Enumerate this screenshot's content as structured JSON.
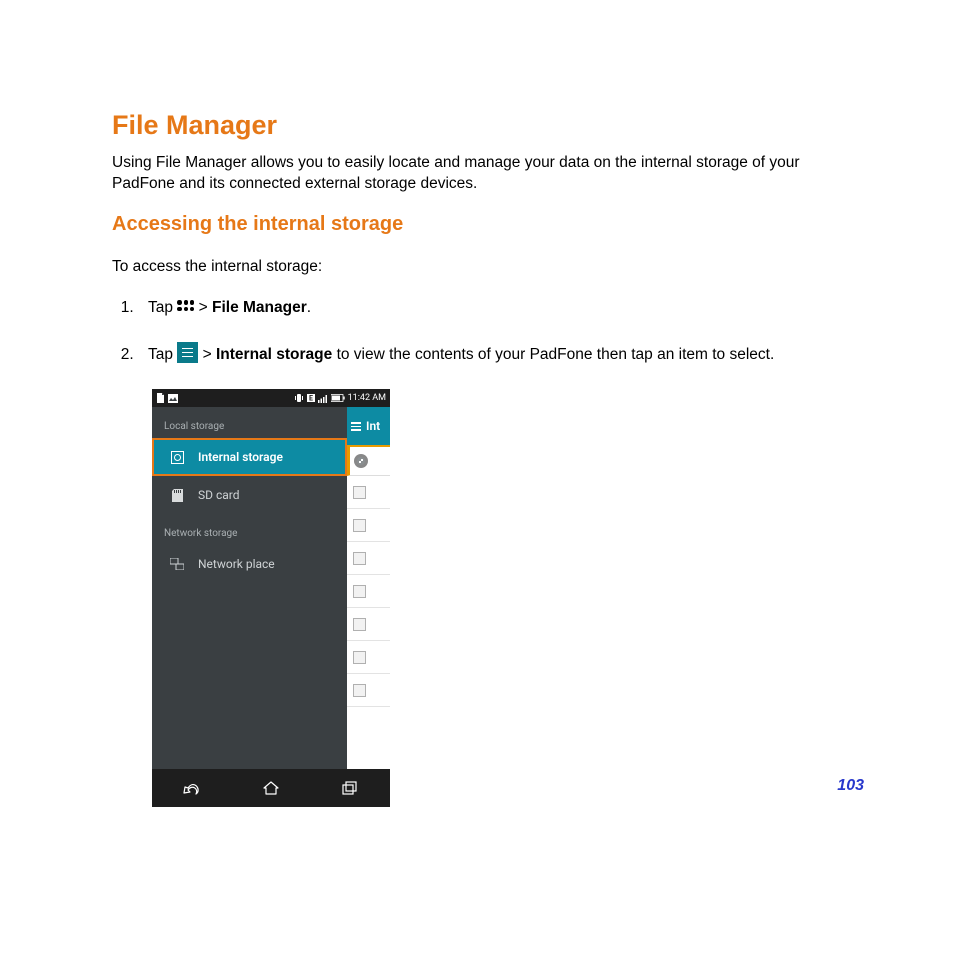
{
  "section": {
    "title": "File Manager",
    "intro": "Using File Manager allows you to easily locate and manage your data on the internal storage of your PadFone and its connected external storage devices.",
    "subtitle": "Accessing the internal storage",
    "lead": "To access the internal storage:"
  },
  "steps": {
    "one_tap": "Tap ",
    "one_gt": " > ",
    "one_target": "File Manager",
    "one_period": ".",
    "two_tap": "Tap ",
    "two_gt": " > ",
    "two_target": "Internal storage",
    "two_rest": " to view the contents of your PadFone then tap an item to select."
  },
  "phone": {
    "time": "11:42 AM",
    "local_label": "Local storage",
    "internal": "Internal storage",
    "sdcard": "SD card",
    "network_label": "Network storage",
    "network_place": "Network place",
    "right_header": "Int"
  },
  "page_number": "103"
}
